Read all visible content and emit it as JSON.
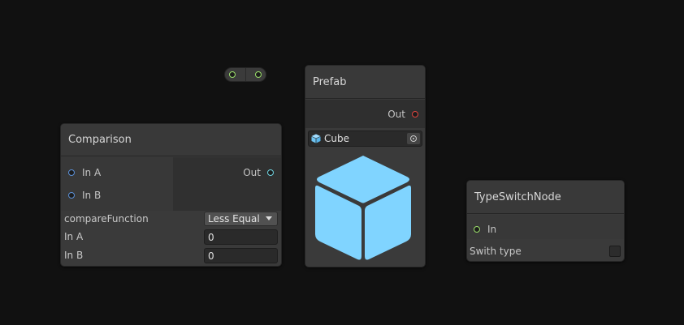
{
  "comparison_node": {
    "title": "Comparison",
    "inputs": [
      {
        "label": "In A"
      },
      {
        "label": "In B"
      }
    ],
    "output": {
      "label": "Out"
    },
    "fields": {
      "compare_function_label": "compareFunction",
      "compare_function_value": "Less Equal",
      "in_a_label": "In A",
      "in_a_value": "0",
      "in_b_label": "In B",
      "in_b_value": "0"
    }
  },
  "prefab_node": {
    "title": "Prefab",
    "output": {
      "label": "Out"
    },
    "object_field": {
      "value": "Cube",
      "icon": "cube-icon"
    },
    "preview_icon": "cube-icon"
  },
  "type_switch_node": {
    "title": "TypeSwitchNode",
    "input": {
      "label": "In"
    },
    "field_label": "Swith type",
    "field_checked": false
  },
  "colors": {
    "background": "#111111",
    "node_body": "#3a3a3a",
    "port_blue": "#5a8fd6",
    "port_green": "#9be06a",
    "port_cyan": "#6fd3e0",
    "port_red": "#e0453f",
    "cube": "#80d4ff"
  }
}
